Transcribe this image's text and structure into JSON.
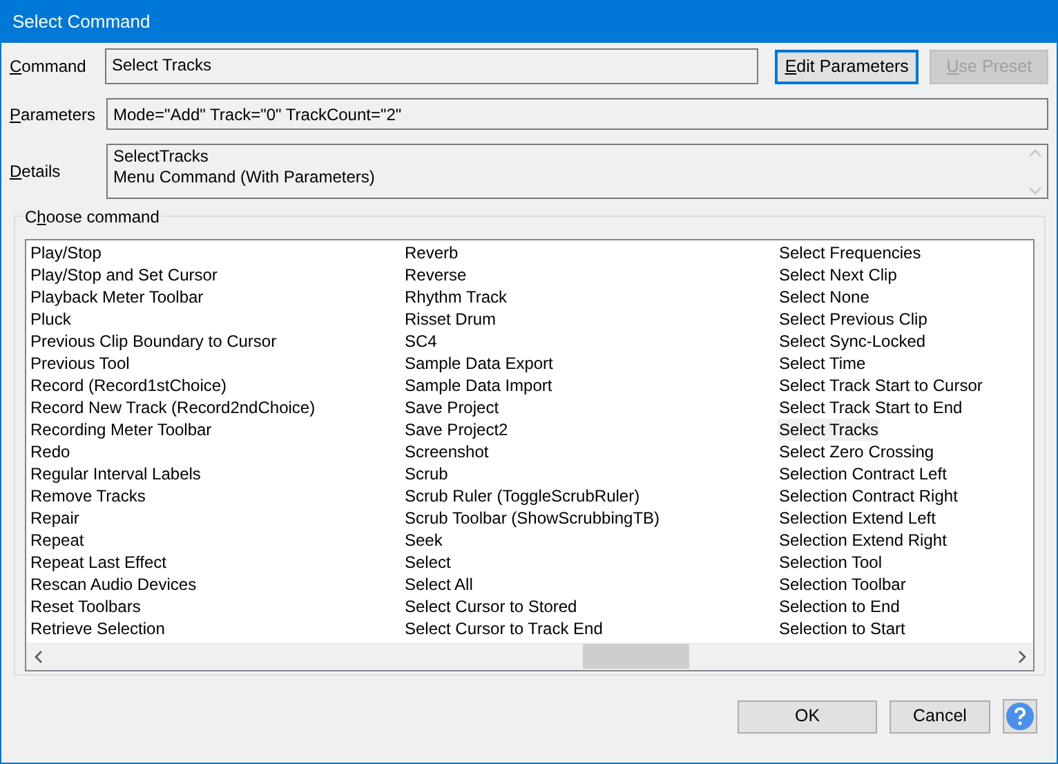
{
  "window": {
    "title": "Select Command"
  },
  "command": {
    "label": {
      "key": "C",
      "after": "ommand"
    },
    "value": "Select Tracks"
  },
  "buttons_top": [
    {
      "label": {
        "key": "E",
        "after": "dit Parameters"
      },
      "disabled": false,
      "focused": true
    },
    {
      "label": {
        "key": "U",
        "after": "se Preset"
      },
      "disabled": true,
      "focused": false
    }
  ],
  "parameters": {
    "label": {
      "key": "P",
      "after": "arameters"
    },
    "value": "Mode=\"Add\" Track=\"0\" TrackCount=\"2\""
  },
  "details": {
    "label": {
      "key": "D",
      "after": "etails"
    },
    "lines": [
      "SelectTracks",
      "Menu Command (With Parameters)"
    ]
  },
  "group": {
    "label": {
      "before": "C",
      "key": "h",
      "after": "oose command"
    },
    "columns": [
      {
        "items": [
          {
            "label": "Play/Stop",
            "selected": false
          },
          {
            "label": "Play/Stop and Set Cursor",
            "selected": false
          },
          {
            "label": "Playback Meter Toolbar",
            "selected": false
          },
          {
            "label": "Pluck",
            "selected": false
          },
          {
            "label": "Previous Clip Boundary to Cursor",
            "selected": false
          },
          {
            "label": "Previous Tool",
            "selected": false
          },
          {
            "label": "Record (Record1stChoice)",
            "selected": false
          },
          {
            "label": "Record New Track (Record2ndChoice)",
            "selected": false
          },
          {
            "label": "Recording Meter Toolbar",
            "selected": false
          },
          {
            "label": "Redo",
            "selected": false
          },
          {
            "label": "Regular Interval Labels",
            "selected": false
          },
          {
            "label": "Remove Tracks",
            "selected": false
          },
          {
            "label": "Repair",
            "selected": false
          },
          {
            "label": "Repeat",
            "selected": false
          },
          {
            "label": "Repeat Last Effect",
            "selected": false
          },
          {
            "label": "Rescan Audio Devices",
            "selected": false
          },
          {
            "label": "Reset Toolbars",
            "selected": false
          },
          {
            "label": "Retrieve Selection",
            "selected": false
          }
        ]
      },
      {
        "items": [
          {
            "label": "Reverb",
            "selected": false
          },
          {
            "label": "Reverse",
            "selected": false
          },
          {
            "label": "Rhythm Track",
            "selected": false
          },
          {
            "label": "Risset Drum",
            "selected": false
          },
          {
            "label": "SC4",
            "selected": false
          },
          {
            "label": "Sample Data Export",
            "selected": false
          },
          {
            "label": "Sample Data Import",
            "selected": false
          },
          {
            "label": "Save Project",
            "selected": false
          },
          {
            "label": "Save Project2",
            "selected": false
          },
          {
            "label": "Screenshot",
            "selected": false
          },
          {
            "label": "Scrub",
            "selected": false
          },
          {
            "label": "Scrub Ruler (ToggleScrubRuler)",
            "selected": false
          },
          {
            "label": "Scrub Toolbar (ShowScrubbingTB)",
            "selected": false
          },
          {
            "label": "Seek",
            "selected": false
          },
          {
            "label": "Select",
            "selected": false
          },
          {
            "label": "Select All",
            "selected": false
          },
          {
            "label": "Select Cursor to Stored",
            "selected": false
          },
          {
            "label": "Select Cursor to Track End",
            "selected": false
          }
        ]
      },
      {
        "items": [
          {
            "label": "Select Frequencies",
            "selected": false
          },
          {
            "label": "Select Next Clip",
            "selected": false
          },
          {
            "label": "Select None",
            "selected": false
          },
          {
            "label": "Select Previous Clip",
            "selected": false
          },
          {
            "label": "Select Sync-Locked",
            "selected": false
          },
          {
            "label": "Select Time",
            "selected": false
          },
          {
            "label": "Select Track Start to Cursor",
            "selected": false
          },
          {
            "label": "Select Track Start to End",
            "selected": false
          },
          {
            "label": "Select Tracks",
            "selected": true
          },
          {
            "label": "Select Zero Crossing",
            "selected": false
          },
          {
            "label": "Selection Contract Left",
            "selected": false
          },
          {
            "label": "Selection Contract Right",
            "selected": false
          },
          {
            "label": "Selection Extend Left",
            "selected": false
          },
          {
            "label": "Selection Extend Right",
            "selected": false
          },
          {
            "label": "Selection Tool",
            "selected": false
          },
          {
            "label": "Selection Toolbar",
            "selected": false
          },
          {
            "label": "Selection to End",
            "selected": false
          },
          {
            "label": "Selection to Start",
            "selected": false
          }
        ]
      }
    ]
  },
  "buttons_bottom": [
    {
      "label": "OK"
    },
    {
      "label": "Cancel"
    }
  ]
}
